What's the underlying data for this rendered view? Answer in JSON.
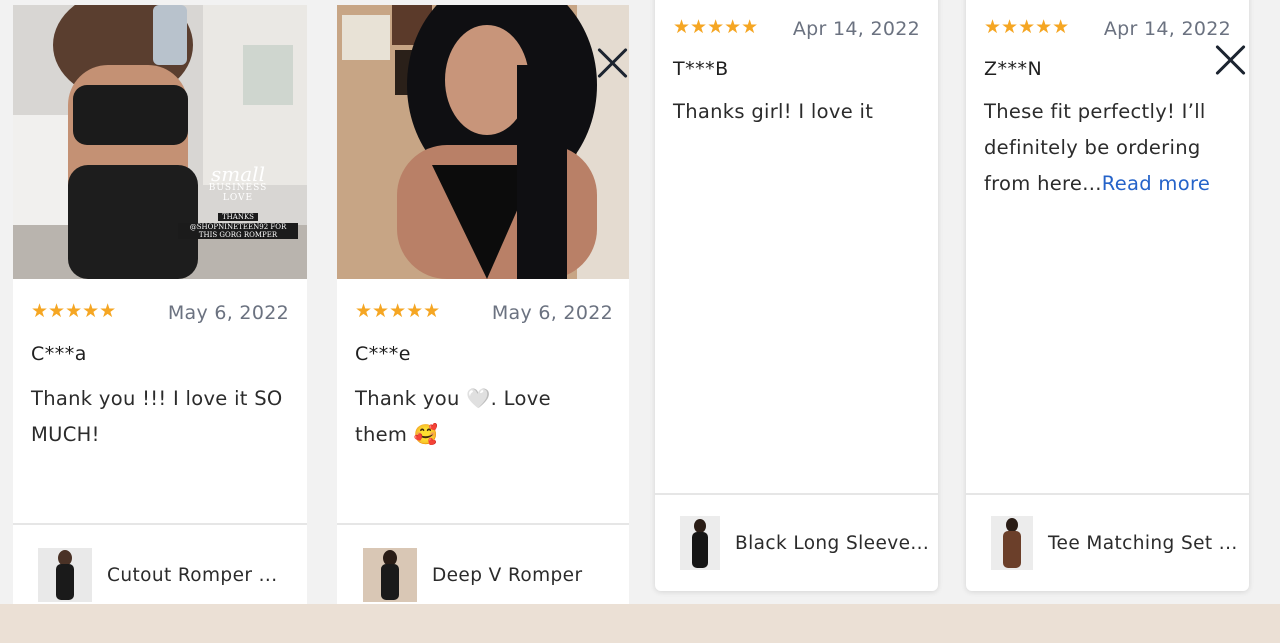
{
  "reviews": [
    {
      "stars": "★★★★★",
      "date": "May 6, 2022",
      "author": "C***a",
      "text": "Thank you !!! I love it SO MUCH!",
      "product": "Cutout Romper ...",
      "photo_caption": [
        "small",
        "BUSINESS",
        "LOVE",
        "THANKS",
        "@SHOPNINETEEN92 FOR",
        "THIS GORG ROMPER"
      ]
    },
    {
      "stars": "★★★★★",
      "date": "May 6, 2022",
      "author": "C***e",
      "text_line1": "Thank you 🤍. Love",
      "text_line2": "them 🥰",
      "product": "Deep V Romper"
    },
    {
      "stars": "★★★★★",
      "date": "Apr 14, 2022",
      "author": "T***B",
      "text": "Thanks girl! I love it",
      "product": "Black Long Sleeve..."
    },
    {
      "stars": "★★★★★",
      "date": "Apr 14, 2022",
      "author": "Z***N",
      "text": "These fit perfectly! I’ll definitely be ordering from here...",
      "read_more": "Read more",
      "product": "Tee Matching Set ..."
    }
  ],
  "colors": {
    "star": "#f5a623",
    "date": "#6b7280",
    "link": "#2563c9",
    "footer": "#ebe0d5"
  },
  "icons": [
    "star-icon",
    "close-icon"
  ]
}
